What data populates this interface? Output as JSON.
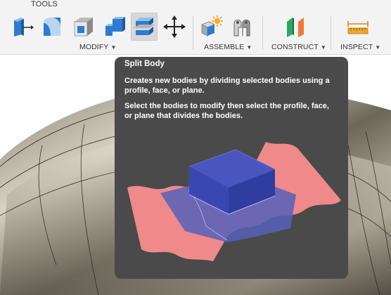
{
  "toolbar": {
    "tab_label": "TOOLS",
    "groups": {
      "modify": "MODIFY",
      "assemble": "ASSEMBLE",
      "construct": "CONSTRUCT",
      "inspect": "INSPECT"
    },
    "tools": [
      {
        "name": "press-pull"
      },
      {
        "name": "fillet"
      },
      {
        "name": "shell"
      },
      {
        "name": "combine"
      },
      {
        "name": "split-body"
      },
      {
        "name": "move"
      },
      {
        "name": "new-component"
      },
      {
        "name": "joint"
      },
      {
        "name": "offset-plane"
      },
      {
        "name": "measure"
      }
    ],
    "active_tool": "split-body"
  },
  "tooltip": {
    "title": "Split Body",
    "description": "Creates new bodies by dividing selected bodies using a profile, face, or plane.",
    "instructions": "Select the bodies to modify then select the profile, face, or plane that divides the bodies.",
    "colors": {
      "background": "#4a4a4a",
      "plane": "#f08a8a",
      "body": "#3a47b0"
    }
  }
}
